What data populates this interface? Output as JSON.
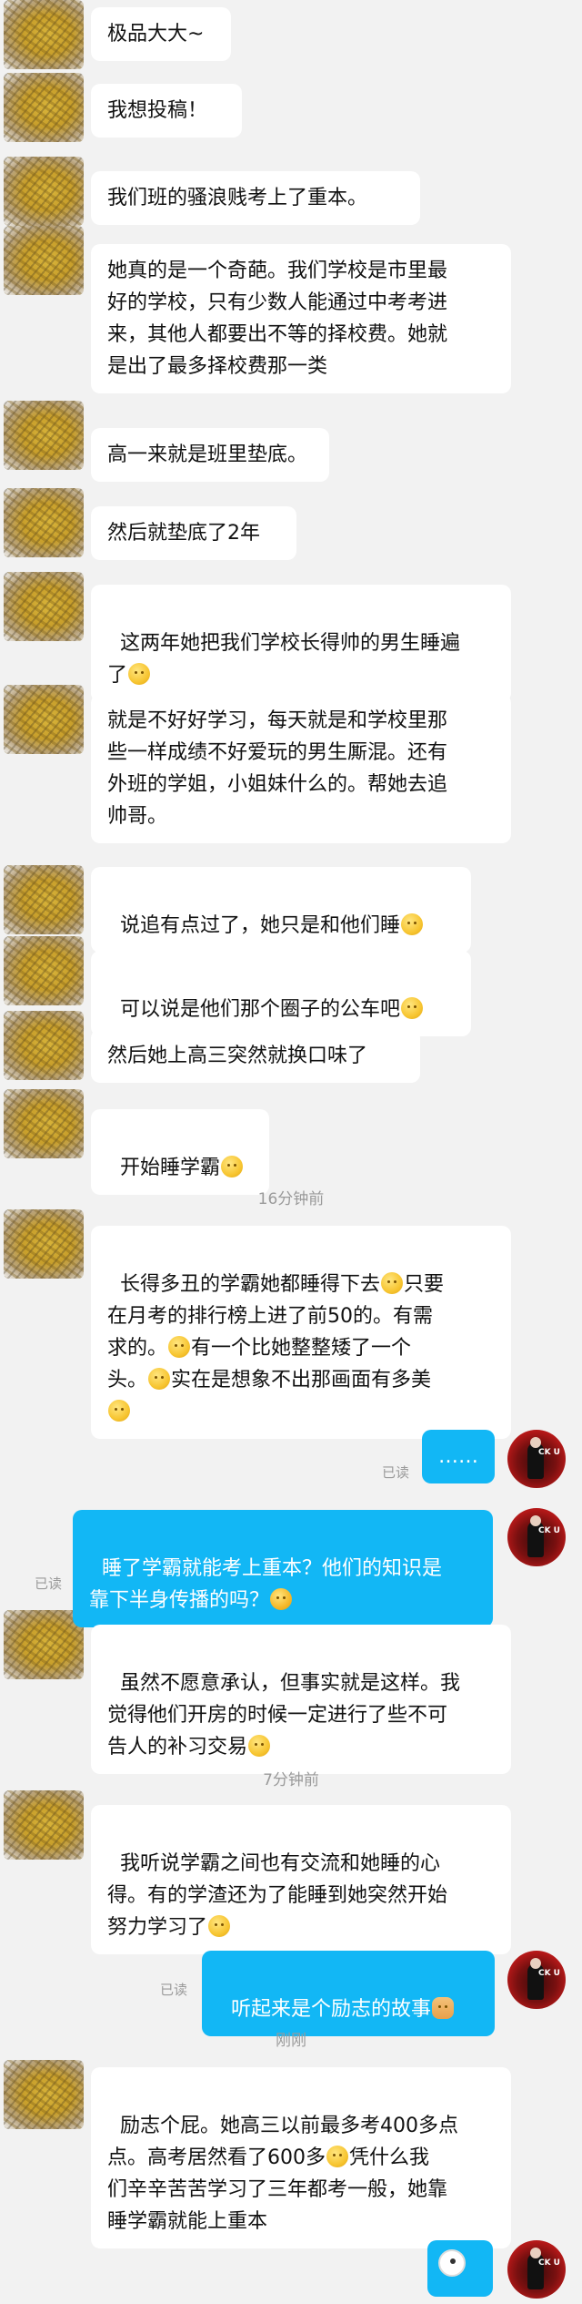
{
  "messages": [
    {
      "text": "极品大大~"
    },
    {
      "text": "我想投稿！"
    },
    {
      "text": "我们班的骚浪贱考上了重本。"
    },
    {
      "text": "她真的是一个奇葩。我们学校是市里最\n好的学校，只有少数人能通过中考考进\n来，其他人都要出不等的择校费。她就\n是出了最多择校费那一类"
    },
    {
      "text": "高一来就是班里垫底。"
    },
    {
      "text": "然后就垫底了2年"
    },
    {
      "text": "这两年她把我们学校长得帅的男生睡遍\n了"
    },
    {
      "text": "就是不好好学习，每天就是和学校里那\n些一样成绩不好爱玩的男生厮混。还有\n外班的学姐，小姐妹什么的。帮她去追\n帅哥。"
    },
    {
      "text": "说追有点过了，她只是和他们睡"
    },
    {
      "text": "可以说是他们那个圈子的公车吧"
    },
    {
      "text": "然后她上高三突然就换口味了"
    },
    {
      "text": "开始睡学霸"
    },
    {
      "p1": "长得多丑的学霸她都睡得下去",
      "p2": "只要\n在月考的排行榜上进了前50的。有需\n求的。",
      "p3": "有一个比她整整矮了一个\n头。",
      "p4": "实在是想象不出那画面有多美\n"
    },
    {
      "text": "……"
    },
    {
      "text": "睡了学霸就能考上重本？他们的知识是\n靠下半身传播的吗？"
    },
    {
      "text": "虽然不愿意承认，但事实就是这样。我\n觉得他们开房的时候一定进行了些不可\n告人的补习交易"
    },
    {
      "text": "我听说学霸之间也有交流和她睡的心\n得。有的学渣还为了能睡到她突然开始\n努力学习了"
    },
    {
      "text": "听起来是个励志的故事"
    },
    {
      "p1": "励志个屁。她高三以前最多考400多点\n点。高考居然看了600多",
      "p2": "凭什么我\n们辛辛苦苦学习了三年都考一般，她靠\n睡学霸就能上重本"
    }
  ],
  "timestamps": [
    "16分钟前",
    "7分钟前",
    "刚刚"
  ],
  "read_label": "已读",
  "avatar_right_text": "CK U",
  "colors": {
    "self_bubble": "#12b7f5",
    "other_bubble": "#ffffff",
    "background": "#f2f2f2",
    "timestamp": "#9a9a9a"
  }
}
